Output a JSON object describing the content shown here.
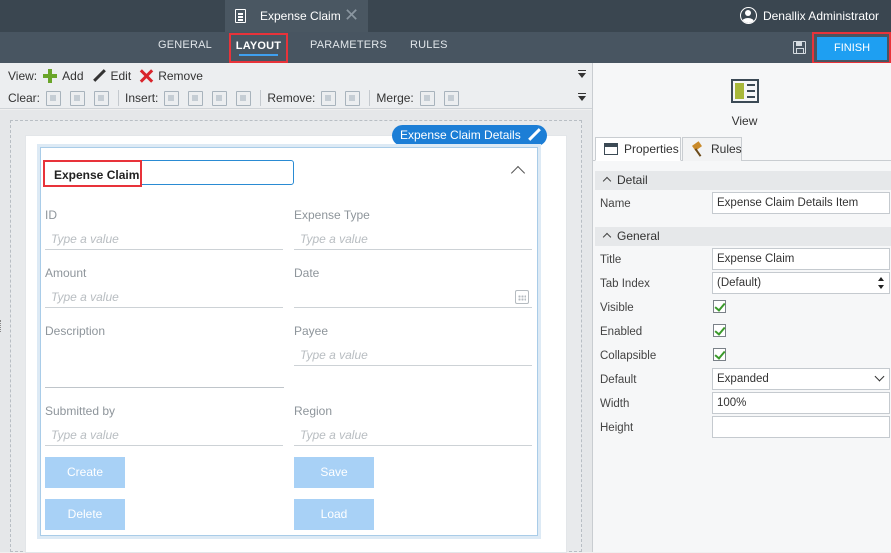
{
  "header": {
    "doc_tab_title": "Expense Claim",
    "user_name": "Denallix Administrator"
  },
  "tabs": {
    "general": "GENERAL",
    "layout": "LAYOUT",
    "parameters": "PARAMETERS",
    "rules": "RULES",
    "active": "LAYOUT"
  },
  "finish_label": "FINISH",
  "toolbar": {
    "view_label": "View:",
    "add_label": "Add",
    "edit_label": "Edit",
    "remove_label": "Remove",
    "clear_label": "Clear:",
    "insert_label": "Insert:",
    "remove2_label": "Remove:",
    "merge_label": "Merge:"
  },
  "canvas": {
    "view_chip": "Expense Claim Details",
    "card_title": "Expense Claim",
    "fields": {
      "id": {
        "label": "ID",
        "placeholder": "Type a value"
      },
      "expense_type": {
        "label": "Expense Type",
        "placeholder": "Type a value"
      },
      "amount": {
        "label": "Amount",
        "placeholder": "Type a value"
      },
      "date": {
        "label": "Date",
        "placeholder": ""
      },
      "description": {
        "label": "Description"
      },
      "payee": {
        "label": "Payee",
        "placeholder": "Type a value"
      },
      "submitted_by": {
        "label": "Submitted by",
        "placeholder": "Type a value"
      },
      "region": {
        "label": "Region",
        "placeholder": "Type a value"
      }
    },
    "buttons": {
      "create": "Create",
      "save": "Save",
      "delete": "Delete",
      "load": "Load"
    }
  },
  "right_panel": {
    "view_label": "View",
    "tab_properties": "Properties",
    "tab_rules": "Rules",
    "section_detail": "Detail",
    "section_general": "General",
    "props": {
      "name_label": "Name",
      "name_value": "Expense Claim Details Item",
      "title_label": "Title",
      "title_value": "Expense Claim",
      "tab_index_label": "Tab Index",
      "tab_index_value": "(Default)",
      "visible_label": "Visible",
      "enabled_label": "Enabled",
      "collapsible_label": "Collapsible",
      "default_label": "Default",
      "default_value": "Expanded",
      "width_label": "Width",
      "width_value": "100%",
      "height_label": "Height",
      "height_value": ""
    }
  },
  "colors": {
    "accent_blue": "#1e9ff2",
    "highlight_red": "#e8333a",
    "button_light_blue": "#a8d1f6"
  }
}
